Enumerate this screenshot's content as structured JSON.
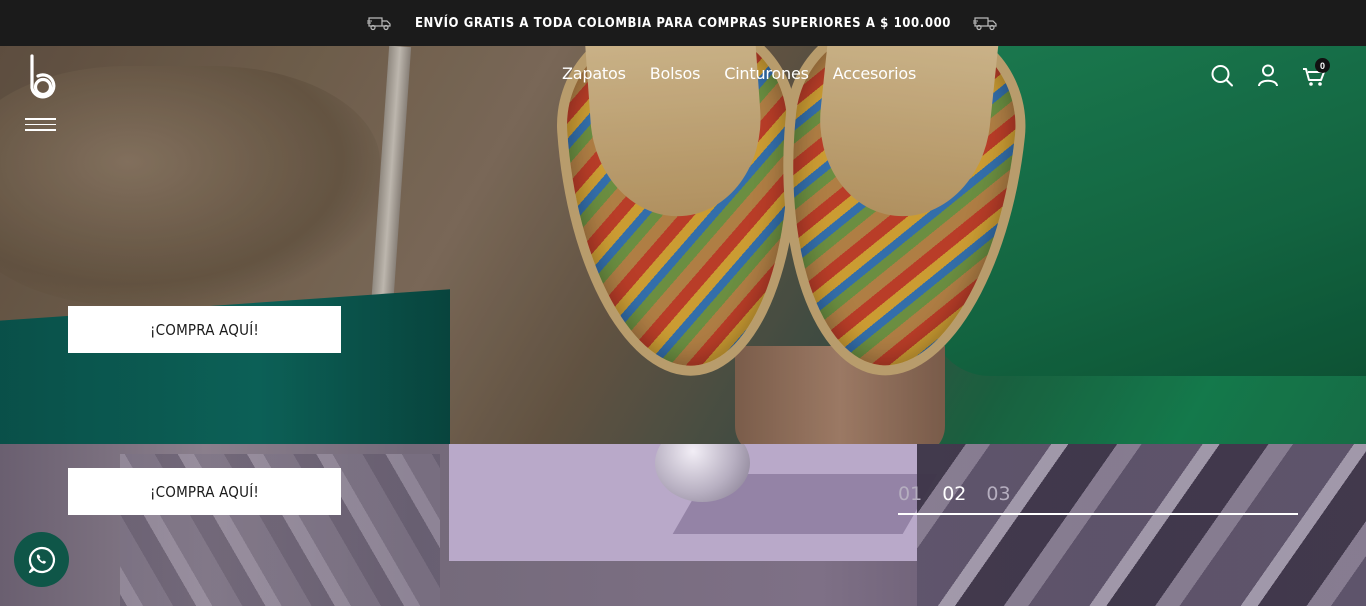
{
  "announcement": {
    "text": "ENVÍO GRATIS A TODA COLOMBIA PARA COMPRAS SUPERIORES A $ 100.000",
    "icon": "truck-icon"
  },
  "header": {
    "logo_text": "b",
    "nav": [
      {
        "label": "Zapatos"
      },
      {
        "label": "Bolsos"
      },
      {
        "label": "Cinturones"
      },
      {
        "label": "Accesorios"
      }
    ],
    "cart_count": "0"
  },
  "hero": {
    "cta_primary": "¡COMPRA AQUÍ!",
    "cta_secondary": "¡COMPRA AQUÍ!"
  },
  "slider": {
    "slides": [
      "01",
      "02",
      "03"
    ],
    "active": "02"
  },
  "colors": {
    "topbar": "#1b1b1b",
    "whatsapp": "#0f5648",
    "cta_bg": "#ffffff"
  }
}
